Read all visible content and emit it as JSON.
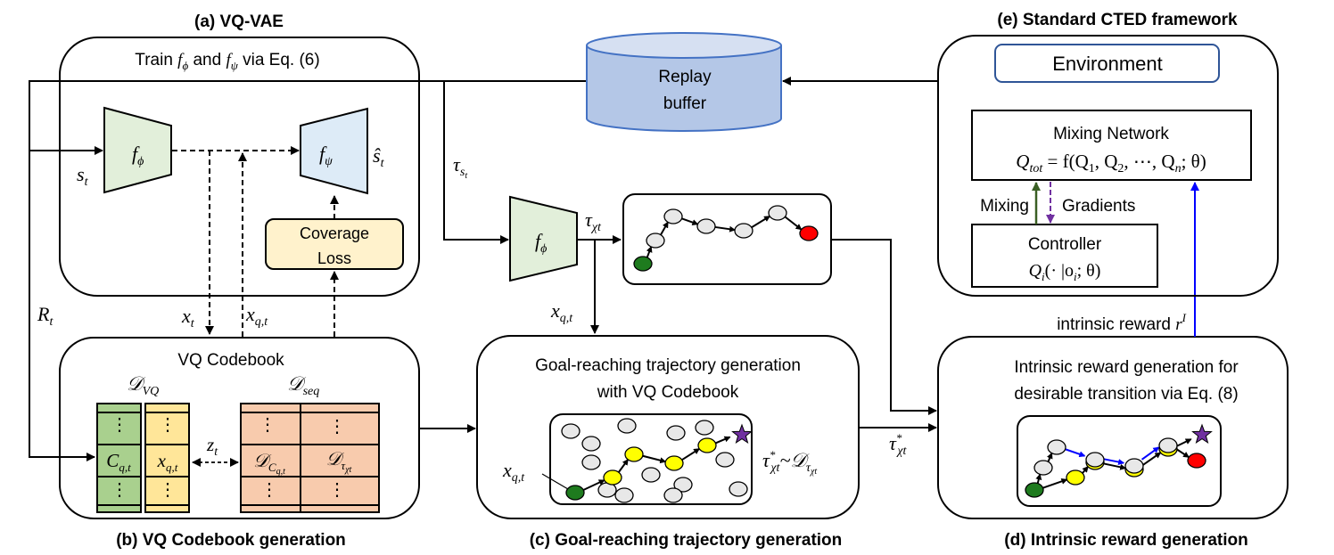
{
  "panels": {
    "a": {
      "caption": "(a) VQ-VAE",
      "train_prefix": "Train ",
      "train_f1": "f",
      "train_f1_sub": "ϕ",
      "train_mid": " and ",
      "train_f2": "f",
      "train_f2_sub": "ψ",
      "train_suffix": " via Eq. (6)",
      "encoder_label": "f",
      "encoder_sub": "ϕ",
      "decoder_label": "f",
      "decoder_sub": "ψ",
      "input_label": "s",
      "input_sub": "t",
      "output_label": "ŝ",
      "output_sub": "t",
      "coverage_line1": "Coverage",
      "coverage_line2": "Loss"
    },
    "b": {
      "caption": "(b) VQ Codebook generation",
      "title": "VQ Codebook",
      "dvq_label": "𝒟",
      "dvq_sub": "VQ",
      "dseq_label": "𝒟",
      "dseq_sub": "seq",
      "col1_cell": "C",
      "col1_sub": "q,t",
      "col2_cell": "x",
      "col2_sub": "q,t",
      "col3_cell": "𝒟",
      "col3_sub": "C",
      "col3_subsub": "q,t",
      "col4_cell": "𝒟",
      "col4_sub": "τ",
      "col4_subsub": "χt",
      "link_label": "z",
      "link_sub": "t",
      "dots": "⋮"
    },
    "c": {
      "caption": "(c) Goal-reaching trajectory generation",
      "title_line1": "Goal-reaching trajectory generation",
      "title_line2": "with VQ Codebook",
      "start_label": "x",
      "start_sub": "q,t",
      "sample_label": "τ",
      "sample_sup": "*",
      "sample_sub": "χt",
      "sample_tilde": "~𝒟",
      "sample_dsub": "τ",
      "sample_dsubsub": "χt"
    },
    "d": {
      "caption": "(d) Intrinsic reward generation",
      "title_line1": "Intrinsic reward generation for",
      "title_line2": "desirable transition via Eq. (8)"
    },
    "e": {
      "caption": "(e) Standard CTED framework",
      "environment": "Environment",
      "mixing_title": "Mixing Network",
      "mixing_formula": "Q",
      "mixing_formula_sub": "tot",
      "mixing_formula_rest": " = f(Q",
      "mixing_q1": "1",
      "mixing_q2": "2",
      "mixing_qn": "n",
      "controller_title": "Controller",
      "controller_formula": "Q",
      "controller_sub": "i",
      "controller_rest": "(· |o",
      "controller_osub": "i",
      "controller_end": "; θ)",
      "mixing_arrow_label": "Mixing",
      "gradient_arrow_label": "Gradients"
    }
  },
  "replay_buffer": {
    "line1": "Replay",
    "line2": "buffer"
  },
  "signals": {
    "R": "R",
    "R_sub": "t",
    "x": "x",
    "x_sub": "t",
    "xq": "x",
    "xq_sub": "q,t",
    "tau_s": "τ",
    "tau_s_sub": "s",
    "tau_s_subsub": "t",
    "tau_chi": "τ",
    "tau_chi_sub": "χt",
    "xq2": "x",
    "xq2_sub": "q,t",
    "tau_star": "τ",
    "tau_star_sup": "*",
    "tau_star_sub": "χt",
    "intrinsic_reward": "intrinsic reward ",
    "r": "r",
    "r_sup": "I"
  },
  "colors": {
    "encoder_fill": "#e2efda",
    "decoder_fill": "#ddebf7",
    "coverage_fill": "#fff2cc",
    "buffer_body": "#b4c7e7",
    "buffer_top": "#d6e0f2",
    "buffer_stroke": "#4472c4",
    "env_stroke": "#2f5597",
    "codebook_green": "#a9d08e",
    "codebook_yellow": "#ffe699",
    "codebook_salmon": "#f8cbad",
    "node_gray": "#e8e8e8",
    "node_start": "#1e7b1e",
    "node_end": "#ff0000",
    "node_path": "#ffff00",
    "goal_star": "#7030a0",
    "mixing_arrow": "#3a5f24",
    "gradient_arrow": "#7030a0",
    "reward_arrow": "#0000ff"
  }
}
